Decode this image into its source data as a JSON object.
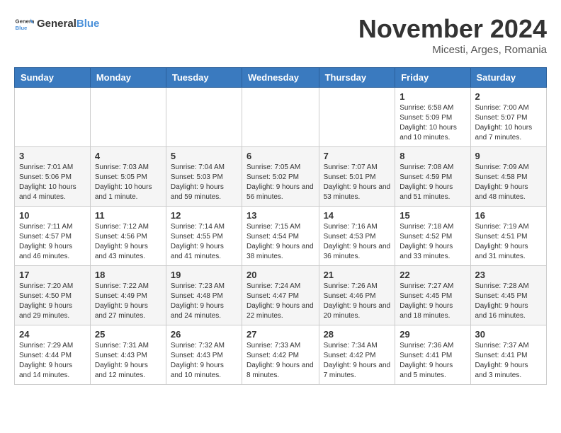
{
  "header": {
    "logo_general": "General",
    "logo_blue": "Blue",
    "month_year": "November 2024",
    "location": "Micesti, Arges, Romania"
  },
  "weekdays": [
    "Sunday",
    "Monday",
    "Tuesday",
    "Wednesday",
    "Thursday",
    "Friday",
    "Saturday"
  ],
  "weeks": [
    [
      {
        "day": "",
        "info": ""
      },
      {
        "day": "",
        "info": ""
      },
      {
        "day": "",
        "info": ""
      },
      {
        "day": "",
        "info": ""
      },
      {
        "day": "",
        "info": ""
      },
      {
        "day": "1",
        "info": "Sunrise: 6:58 AM\nSunset: 5:09 PM\nDaylight: 10 hours and 10 minutes."
      },
      {
        "day": "2",
        "info": "Sunrise: 7:00 AM\nSunset: 5:07 PM\nDaylight: 10 hours and 7 minutes."
      }
    ],
    [
      {
        "day": "3",
        "info": "Sunrise: 7:01 AM\nSunset: 5:06 PM\nDaylight: 10 hours and 4 minutes."
      },
      {
        "day": "4",
        "info": "Sunrise: 7:03 AM\nSunset: 5:05 PM\nDaylight: 10 hours and 1 minute."
      },
      {
        "day": "5",
        "info": "Sunrise: 7:04 AM\nSunset: 5:03 PM\nDaylight: 9 hours and 59 minutes."
      },
      {
        "day": "6",
        "info": "Sunrise: 7:05 AM\nSunset: 5:02 PM\nDaylight: 9 hours and 56 minutes."
      },
      {
        "day": "7",
        "info": "Sunrise: 7:07 AM\nSunset: 5:01 PM\nDaylight: 9 hours and 53 minutes."
      },
      {
        "day": "8",
        "info": "Sunrise: 7:08 AM\nSunset: 4:59 PM\nDaylight: 9 hours and 51 minutes."
      },
      {
        "day": "9",
        "info": "Sunrise: 7:09 AM\nSunset: 4:58 PM\nDaylight: 9 hours and 48 minutes."
      }
    ],
    [
      {
        "day": "10",
        "info": "Sunrise: 7:11 AM\nSunset: 4:57 PM\nDaylight: 9 hours and 46 minutes."
      },
      {
        "day": "11",
        "info": "Sunrise: 7:12 AM\nSunset: 4:56 PM\nDaylight: 9 hours and 43 minutes."
      },
      {
        "day": "12",
        "info": "Sunrise: 7:14 AM\nSunset: 4:55 PM\nDaylight: 9 hours and 41 minutes."
      },
      {
        "day": "13",
        "info": "Sunrise: 7:15 AM\nSunset: 4:54 PM\nDaylight: 9 hours and 38 minutes."
      },
      {
        "day": "14",
        "info": "Sunrise: 7:16 AM\nSunset: 4:53 PM\nDaylight: 9 hours and 36 minutes."
      },
      {
        "day": "15",
        "info": "Sunrise: 7:18 AM\nSunset: 4:52 PM\nDaylight: 9 hours and 33 minutes."
      },
      {
        "day": "16",
        "info": "Sunrise: 7:19 AM\nSunset: 4:51 PM\nDaylight: 9 hours and 31 minutes."
      }
    ],
    [
      {
        "day": "17",
        "info": "Sunrise: 7:20 AM\nSunset: 4:50 PM\nDaylight: 9 hours and 29 minutes."
      },
      {
        "day": "18",
        "info": "Sunrise: 7:22 AM\nSunset: 4:49 PM\nDaylight: 9 hours and 27 minutes."
      },
      {
        "day": "19",
        "info": "Sunrise: 7:23 AM\nSunset: 4:48 PM\nDaylight: 9 hours and 24 minutes."
      },
      {
        "day": "20",
        "info": "Sunrise: 7:24 AM\nSunset: 4:47 PM\nDaylight: 9 hours and 22 minutes."
      },
      {
        "day": "21",
        "info": "Sunrise: 7:26 AM\nSunset: 4:46 PM\nDaylight: 9 hours and 20 minutes."
      },
      {
        "day": "22",
        "info": "Sunrise: 7:27 AM\nSunset: 4:45 PM\nDaylight: 9 hours and 18 minutes."
      },
      {
        "day": "23",
        "info": "Sunrise: 7:28 AM\nSunset: 4:45 PM\nDaylight: 9 hours and 16 minutes."
      }
    ],
    [
      {
        "day": "24",
        "info": "Sunrise: 7:29 AM\nSunset: 4:44 PM\nDaylight: 9 hours and 14 minutes."
      },
      {
        "day": "25",
        "info": "Sunrise: 7:31 AM\nSunset: 4:43 PM\nDaylight: 9 hours and 12 minutes."
      },
      {
        "day": "26",
        "info": "Sunrise: 7:32 AM\nSunset: 4:43 PM\nDaylight: 9 hours and 10 minutes."
      },
      {
        "day": "27",
        "info": "Sunrise: 7:33 AM\nSunset: 4:42 PM\nDaylight: 9 hours and 8 minutes."
      },
      {
        "day": "28",
        "info": "Sunrise: 7:34 AM\nSunset: 4:42 PM\nDaylight: 9 hours and 7 minutes."
      },
      {
        "day": "29",
        "info": "Sunrise: 7:36 AM\nSunset: 4:41 PM\nDaylight: 9 hours and 5 minutes."
      },
      {
        "day": "30",
        "info": "Sunrise: 7:37 AM\nSunset: 4:41 PM\nDaylight: 9 hours and 3 minutes."
      }
    ]
  ]
}
